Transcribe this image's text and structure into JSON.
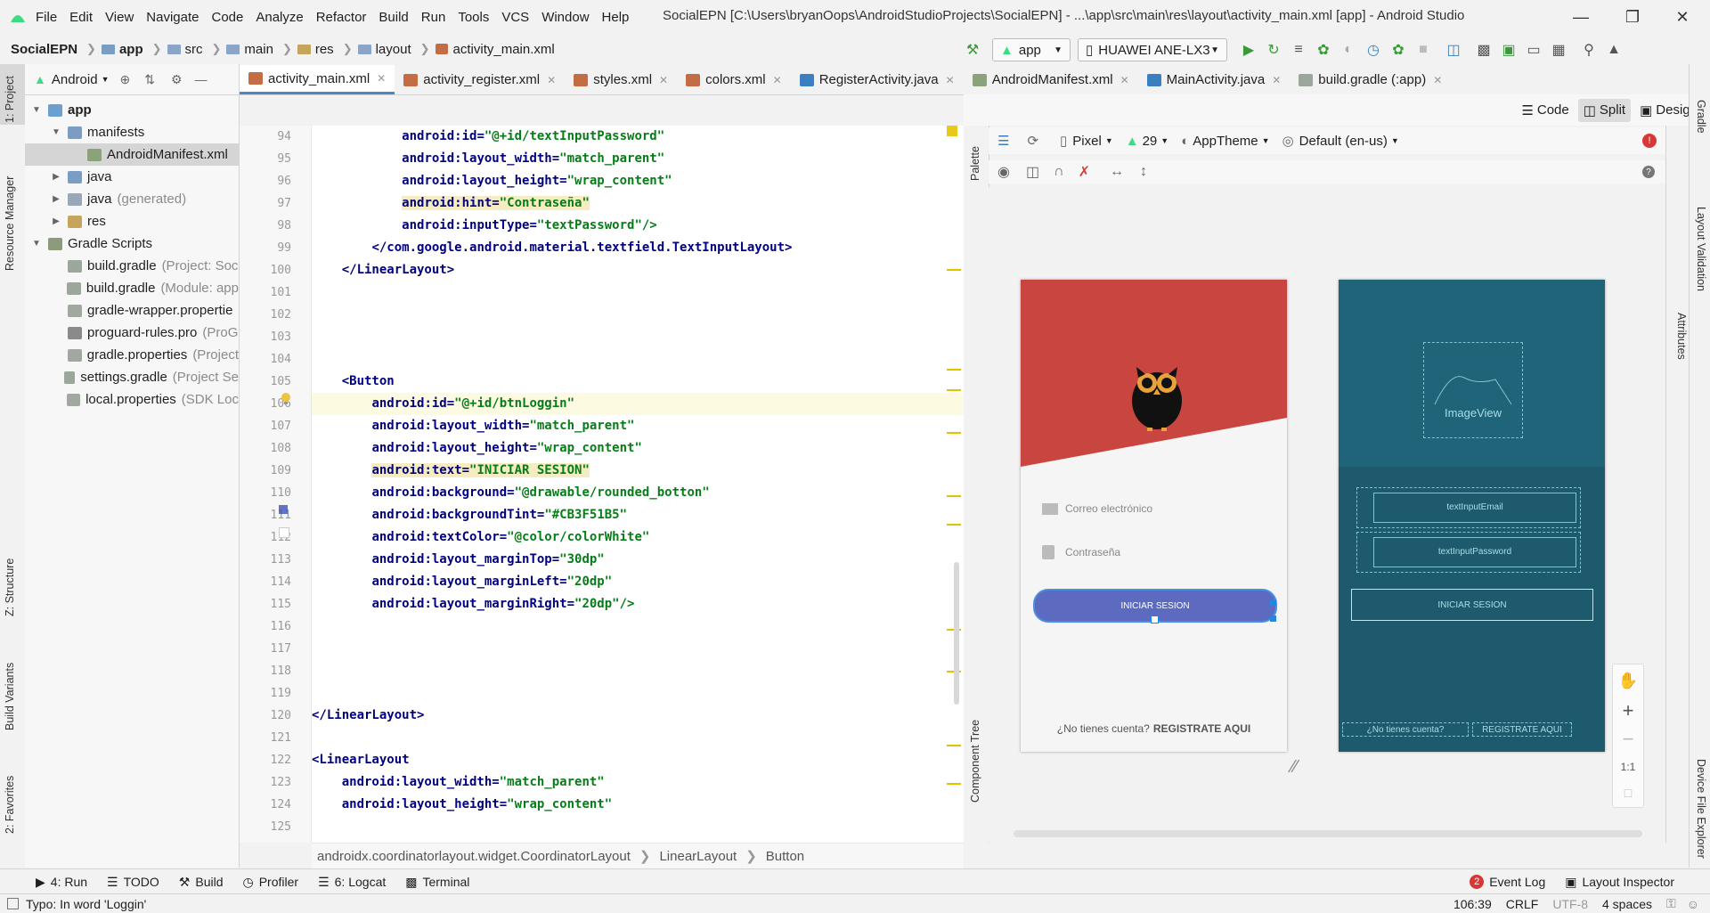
{
  "menu": {
    "items": [
      "File",
      "Edit",
      "View",
      "Navigate",
      "Code",
      "Analyze",
      "Refactor",
      "Build",
      "Run",
      "Tools",
      "VCS",
      "Window",
      "Help"
    ],
    "window_title": "SocialEPN [C:\\Users\\bryanOops\\AndroidStudioProjects\\SocialEPN] - ...\\app\\src\\main\\res\\layout\\activity_main.xml [app] - Android Studio"
  },
  "breadcrumbs": [
    "SocialEPN",
    "app",
    "src",
    "main",
    "res",
    "layout",
    "activity_main.xml"
  ],
  "toolbar": {
    "config": "app",
    "device": "HUAWEI ANE-LX3"
  },
  "left_strip": {
    "project": "1: Project",
    "resource_manager": "Resource Manager",
    "structure": "Z: Structure",
    "build_variants": "Build Variants",
    "favorites": "2: Favorites"
  },
  "project_panel": {
    "view_label": "Android",
    "tree": [
      {
        "label": "app",
        "hint": ""
      },
      {
        "label": "manifests",
        "hint": ""
      },
      {
        "label": "AndroidManifest.xml",
        "hint": ""
      },
      {
        "label": "java",
        "hint": ""
      },
      {
        "label": "java",
        "hint": "(generated)"
      },
      {
        "label": "res",
        "hint": ""
      },
      {
        "label": "Gradle Scripts",
        "hint": ""
      },
      {
        "label": "build.gradle",
        "hint": "(Project: Soc"
      },
      {
        "label": "build.gradle",
        "hint": "(Module: app"
      },
      {
        "label": "gradle-wrapper.propertie",
        "hint": ""
      },
      {
        "label": "proguard-rules.pro",
        "hint": "(ProG"
      },
      {
        "label": "gradle.properties",
        "hint": "(Project"
      },
      {
        "label": "settings.gradle",
        "hint": "(Project Se"
      },
      {
        "label": "local.properties",
        "hint": "(SDK Loc"
      }
    ]
  },
  "tabs": [
    "activity_main.xml",
    "activity_register.xml",
    "styles.xml",
    "colors.xml",
    "RegisterActivity.java",
    "AndroidManifest.xml",
    "MainActivity.java",
    "build.gradle (:app)"
  ],
  "view_modes": {
    "code": "Code",
    "split": "Split",
    "design": "Design"
  },
  "design_toolbar": {
    "device": "Pixel",
    "api": "29",
    "theme": "AppTheme",
    "locale": "Default (en-us)"
  },
  "side_labels": {
    "palette": "Palette",
    "component_tree": "Component Tree",
    "gradle": "Gradle",
    "attributes": "Attributes",
    "layout_validation": "Layout Validation",
    "device_file_explorer": "Device File Explorer"
  },
  "code": {
    "line_numbers": [
      "94",
      "95",
      "96",
      "97",
      "98",
      "99",
      "100",
      "101",
      "102",
      "103",
      "104",
      "105",
      "106",
      "107",
      "108",
      "109",
      "110",
      "111",
      "112",
      "113",
      "114",
      "115",
      "116",
      "117",
      "118",
      "119",
      "120",
      "121",
      "122",
      "123",
      "124",
      "125"
    ],
    "lines": [
      {
        "indent": "            ",
        "attr": "android:id=",
        "val": "\"@+id/textInputPassword\""
      },
      {
        "indent": "            ",
        "attr": "android:layout_width=",
        "val": "\"match_parent\""
      },
      {
        "indent": "            ",
        "attr": "android:layout_height=",
        "val": "\"wrap_content\""
      },
      {
        "indent": "            ",
        "attr": "android:hint=",
        "val": "\"Contraseña\""
      },
      {
        "indent": "            ",
        "attr": "android:inputType=",
        "val": "\"textPassword\"/>"
      },
      {
        "indent": "        ",
        "attr": "</com.google.android.material.textfield.TextInputLayout>",
        "val": ""
      },
      {
        "indent": "    ",
        "attr": "</LinearLayout>",
        "val": ""
      },
      {
        "indent": "",
        "attr": "",
        "val": ""
      },
      {
        "indent": "",
        "attr": "",
        "val": ""
      },
      {
        "indent": "",
        "attr": "",
        "val": ""
      },
      {
        "indent": "",
        "attr": "",
        "val": ""
      },
      {
        "indent": "    ",
        "attr": "<Button",
        "val": ""
      },
      {
        "indent": "        ",
        "attr": "android:id=",
        "val": "\"@+id/btnLoggin\""
      },
      {
        "indent": "        ",
        "attr": "android:layout_width=",
        "val": "\"match_parent\""
      },
      {
        "indent": "        ",
        "attr": "android:layout_height=",
        "val": "\"wrap_content\""
      },
      {
        "indent": "        ",
        "attr": "android:text=",
        "val": "\"INICIAR SESION\""
      },
      {
        "indent": "        ",
        "attr": "android:background=",
        "val": "\"@drawable/rounded_botton\""
      },
      {
        "indent": "        ",
        "attr": "android:backgroundTint=",
        "val": "\"#CB3F51B5\""
      },
      {
        "indent": "        ",
        "attr": "android:textColor=",
        "val": "\"@color/colorWhite\""
      },
      {
        "indent": "        ",
        "attr": "android:layout_marginTop=",
        "val": "\"30dp\""
      },
      {
        "indent": "        ",
        "attr": "android:layout_marginLeft=",
        "val": "\"20dp\""
      },
      {
        "indent": "        ",
        "attr": "android:layout_marginRight=",
        "val": "\"20dp\"/>"
      },
      {
        "indent": "",
        "attr": "",
        "val": ""
      },
      {
        "indent": "",
        "attr": "",
        "val": ""
      },
      {
        "indent": "",
        "attr": "",
        "val": ""
      },
      {
        "indent": "",
        "attr": "",
        "val": ""
      },
      {
        "indent": "",
        "attr": "</LinearLayout>",
        "val": ""
      },
      {
        "indent": "",
        "attr": "",
        "val": ""
      },
      {
        "indent": "",
        "attr": "<LinearLayout",
        "val": ""
      },
      {
        "indent": "    ",
        "attr": "android:layout_width=",
        "val": "\"match_parent\""
      },
      {
        "indent": "    ",
        "attr": "android:layout_height=",
        "val": "\"wrap_content\""
      },
      {
        "indent": "    ",
        "attr": "",
        "val": ""
      }
    ]
  },
  "preview": {
    "email_hint": "Correo electrónico",
    "password_hint": "Contraseña",
    "button_text": "INICIAR SESION",
    "footer_question": "¿No tienes cuenta?",
    "footer_link": "REGISTRATE AQUI",
    "blueprint": {
      "image": "ImageView",
      "image_small": "View",
      "email": "textInputEmail",
      "password": "textInputPassword",
      "button": "INICIAR SESION",
      "q": "¿No tienes cuenta?",
      "link": "REGISTRATE AQUI"
    },
    "zoom_one": "1:1",
    "colors": {
      "header": "#c94640",
      "button": "#5c6bbf",
      "blueprint": "#1e5a6e"
    }
  },
  "code_breadcrumbs": [
    "androidx.coordinatorlayout.widget.CoordinatorLayout",
    "LinearLayout",
    "Button"
  ],
  "tool_windows": {
    "run": "4: Run",
    "todo": "TODO",
    "build": "Build",
    "profiler": "Profiler",
    "logcat": "6: Logcat",
    "terminal": "Terminal",
    "event_log": "Event Log",
    "event_count": "2",
    "layout_inspector": "Layout Inspector"
  },
  "status": {
    "message": "Typo: In word 'Loggin'",
    "position": "106:39",
    "line_sep": "CRLF",
    "encoding": "UTF-8",
    "indent": "4 spaces"
  }
}
